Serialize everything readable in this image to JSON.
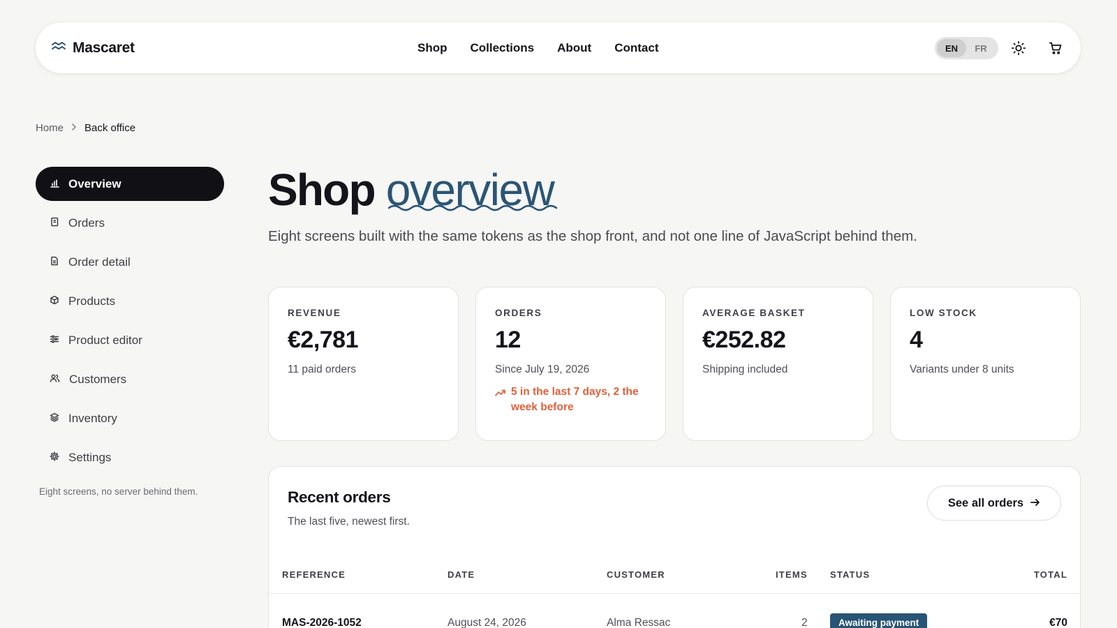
{
  "header": {
    "brand": "Mascaret",
    "nav": [
      "Shop",
      "Collections",
      "About",
      "Contact"
    ],
    "lang_options": [
      "EN",
      "FR"
    ],
    "lang_active": "EN",
    "icons": [
      "waves-logo-icon",
      "sun-icon",
      "cart-icon"
    ]
  },
  "breadcrumb": {
    "home": "Home",
    "current": "Back office"
  },
  "sidebar": {
    "items": [
      {
        "label": "Overview",
        "icon": "bar-chart-icon",
        "active": true
      },
      {
        "label": "Orders",
        "icon": "receipt-icon"
      },
      {
        "label": "Order detail",
        "icon": "document-icon"
      },
      {
        "label": "Products",
        "icon": "box-icon"
      },
      {
        "label": "Product editor",
        "icon": "sliders-icon"
      },
      {
        "label": "Customers",
        "icon": "users-icon"
      },
      {
        "label": "Inventory",
        "icon": "layers-icon"
      },
      {
        "label": "Settings",
        "icon": "gear-icon"
      }
    ],
    "note": "Eight screens, no server behind them."
  },
  "main": {
    "title_plain": "Shop",
    "title_accent": "overview",
    "subtitle": "Eight screens built with the same tokens as the shop front, and not one line of JavaScript behind them.",
    "cards": [
      {
        "label": "REVENUE",
        "value": "€2,781",
        "note": "11 paid orders"
      },
      {
        "label": "ORDERS",
        "value": "12",
        "note": "Since July 19, 2026",
        "trend": "5 in the last 7 days, 2 the week before"
      },
      {
        "label": "AVERAGE BASKET",
        "value": "€252.82",
        "note": "Shipping included"
      },
      {
        "label": "LOW STOCK",
        "value": "4",
        "note": "Variants under 8 units"
      }
    ],
    "recent": {
      "title": "Recent orders",
      "subtitle": "The last five, newest first.",
      "see_all": "See all orders",
      "columns": [
        "REFERENCE",
        "DATE",
        "CUSTOMER",
        "ITEMS",
        "STATUS",
        "TOTAL"
      ],
      "rows": [
        {
          "reference": "MAS-2026-1052",
          "date": "August 24, 2026",
          "customer": "Alma Ressac",
          "items": "2",
          "status": "Awaiting payment",
          "total": "€70"
        }
      ]
    }
  },
  "colors": {
    "accent": "#2b5575",
    "trend": "#e0623c",
    "dark": "#111115",
    "badge": "#285475"
  }
}
